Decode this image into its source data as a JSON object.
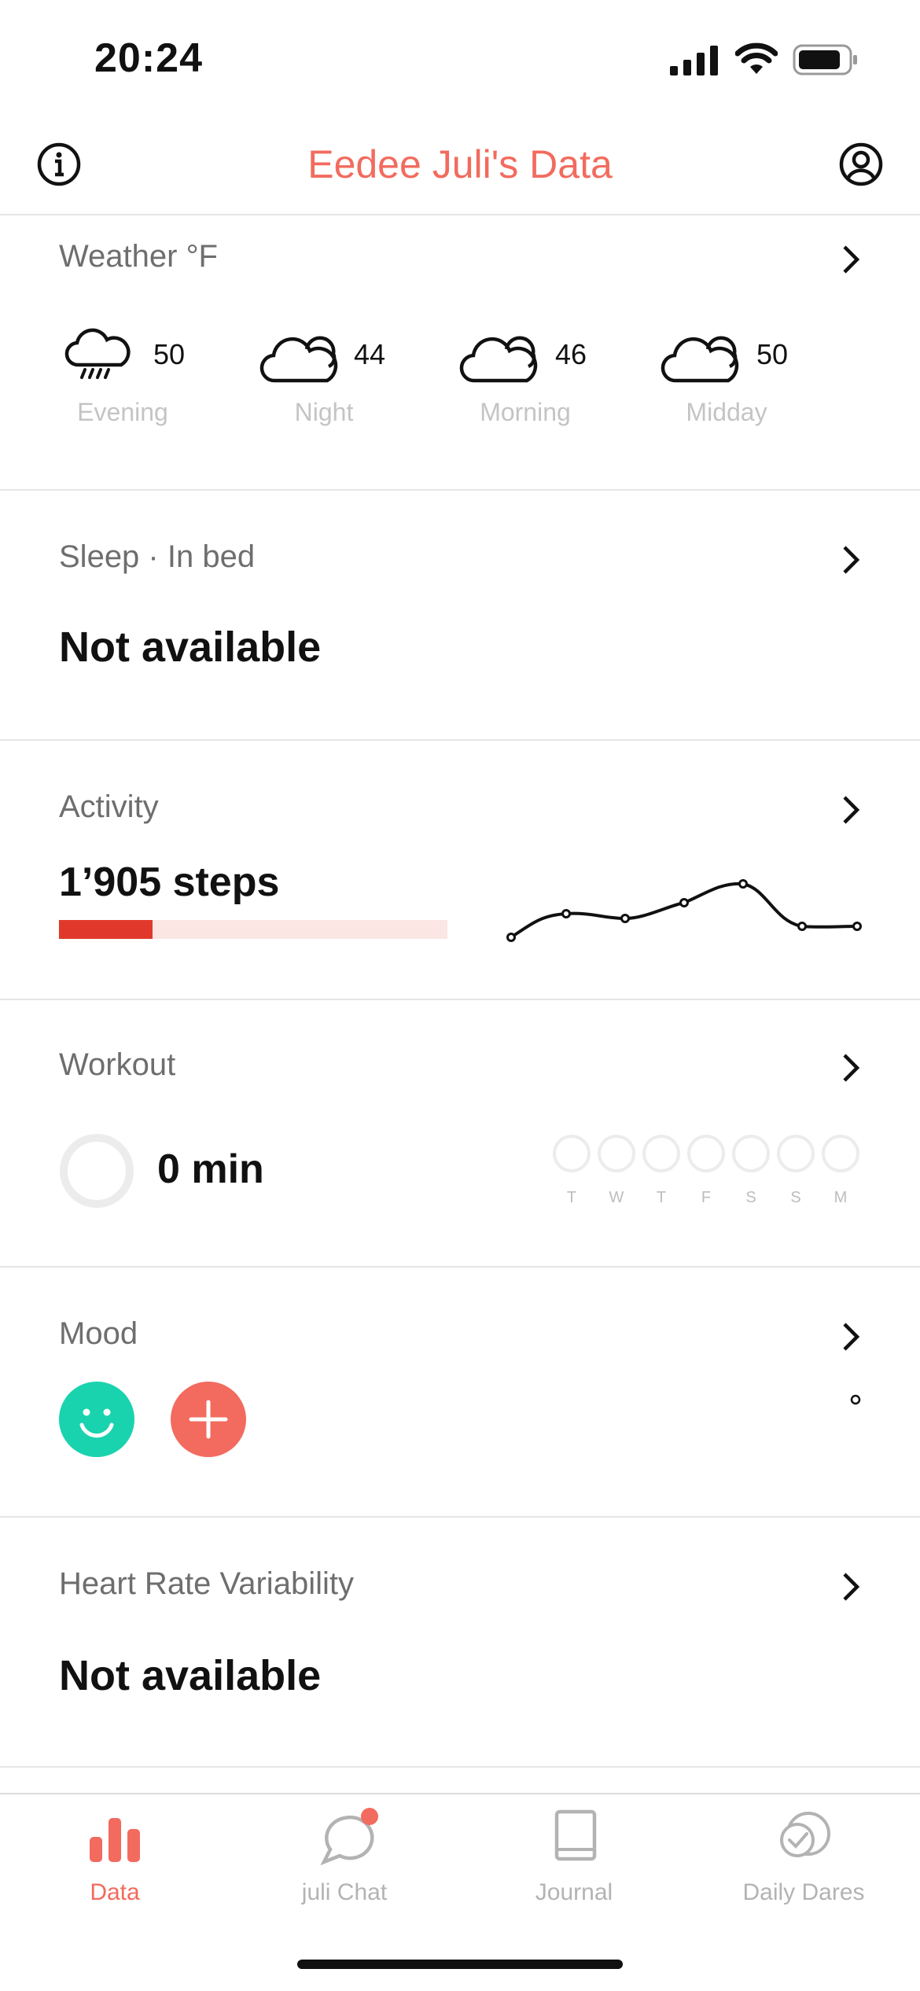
{
  "status_bar": {
    "time": "20:24"
  },
  "header": {
    "title": "Eedee Juli's Data"
  },
  "weather": {
    "title": "Weather °F",
    "items": [
      {
        "temp": "50",
        "label": "Evening",
        "icon": "cloud-rain-moon-icon"
      },
      {
        "temp": "44",
        "label": "Night",
        "icon": "cloud-icon"
      },
      {
        "temp": "46",
        "label": "Morning",
        "icon": "cloud-icon"
      },
      {
        "temp": "50",
        "label": "Midday",
        "icon": "cloud-icon"
      }
    ]
  },
  "sleep": {
    "title": "Sleep · In bed",
    "value": "Not available"
  },
  "activity": {
    "title": "Activity",
    "steps": "1’905 steps",
    "progress": 0.24,
    "colors": {
      "fill": "#e0392b",
      "track": "#fbe6e4"
    }
  },
  "workout": {
    "title": "Workout",
    "value": "0 min",
    "days": [
      "T",
      "W",
      "T",
      "F",
      "S",
      "S",
      "M"
    ]
  },
  "mood": {
    "title": "Mood",
    "colors": {
      "mood": "#19d3ae",
      "add": "#f26b5e"
    }
  },
  "hrv": {
    "title": "Heart Rate Variability",
    "value": "Not available"
  },
  "tabs": [
    {
      "label": "Data",
      "icon": "bar-chart-icon",
      "active": true
    },
    {
      "label": "juli Chat",
      "icon": "chat-bubble-icon",
      "active": false
    },
    {
      "label": "Journal",
      "icon": "book-icon",
      "active": false
    },
    {
      "label": "Daily Dares",
      "icon": "check-circle-icon",
      "active": false
    }
  ],
  "colors": {
    "accent": "#f26b5e"
  }
}
